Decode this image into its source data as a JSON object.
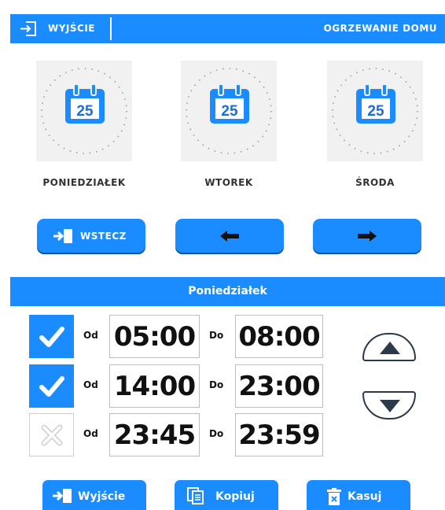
{
  "header": {
    "exit_label": "WYJŚCIE",
    "title": "OGRZEWANIE DOMU"
  },
  "days": [
    {
      "name": "PONIEDZIAŁEK",
      "date": "25"
    },
    {
      "name": "WTOREK",
      "date": "25"
    },
    {
      "name": "ŚRODA",
      "date": "25"
    }
  ],
  "nav": {
    "back_label": "WSTECZ"
  },
  "schedule": {
    "title": "Poniedziałek",
    "from_label": "Od",
    "to_label": "Do",
    "rows": [
      {
        "enabled": true,
        "from": "05:00",
        "to": "08:00"
      },
      {
        "enabled": true,
        "from": "14:00",
        "to": "23:00"
      },
      {
        "enabled": false,
        "from": "23:45",
        "to": "23:59"
      }
    ]
  },
  "footer": {
    "exit_label": "Wyjście",
    "copy_label": "Kopiuj",
    "delete_label": "Kasuj"
  },
  "colors": {
    "accent": "#1a8cff",
    "dark": "#2b3a4a"
  }
}
